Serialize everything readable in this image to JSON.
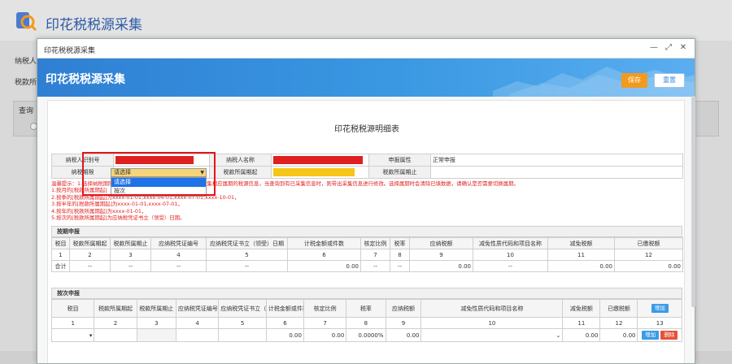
{
  "background": {
    "title": "印花税税源采集",
    "label_taxpayer": "纳税人",
    "label_period": "税款所",
    "query_label": "查询"
  },
  "modal": {
    "title": "印花税税源采集",
    "win_minimize": "—",
    "win_maximize": "⤢",
    "win_close": "✕",
    "banner_title": "印花税税源采集",
    "save_label": "保存",
    "reset_label": "重置"
  },
  "doc": {
    "title": "印花税税源明细表",
    "taxpayer_id_label": "纳税人识别号",
    "taxpayer_name_label": "纳税人名称",
    "declare_attr_label": "申报属性",
    "declare_attr_value": "正常申报",
    "tax_period_label": "纳税期限",
    "period_start_label": "税款所属期起",
    "period_end_label": "税款所属期止",
    "dropdown_value": "请选择",
    "dropdown_options": [
      "请选择",
      "按次"
    ],
    "tips": [
      "温馨提示：1.选择纳税期限时，税款所属期起止需要按照纳税期限采集相应属期的税源信息，当查询到有已采集信息时，则带出采集信息进行修改。选择属期时会清除已填数据，请确认是否需要切换属期。",
      "1.按月的[税款所属期起]",
      "2.按季的[税款所属期起]为xxxx-01-01,xxxx-04-01,xxxx-07-01,xxxx-10-01，",
      "3.按半年的[税款所属期起]为xxxx-01-01,xxxx-07-01，",
      "4.按年的[税款所属期起]为xxxx-01-01，",
      "5.按次的[税款所属期起]为应纳税凭证书立（领受）日期。"
    ]
  },
  "period_section": {
    "title": "按期申报",
    "headers": [
      "税目",
      "税款所属期起",
      "税款所属期止",
      "应纳税凭证编号",
      "应纳税凭证书立（领受）日期",
      "计税金额或件数",
      "核定比例",
      "税率",
      "应纳税额",
      "减免性质代码和项目名称",
      "减免税额",
      "已缴税额"
    ],
    "index_row": [
      "1",
      "2",
      "3",
      "4",
      "5",
      "6",
      "7",
      "8",
      "9",
      "10",
      "11",
      "12"
    ],
    "total_row": [
      "合计",
      "--",
      "--",
      "--",
      "--",
      "0.00",
      "--",
      "--",
      "0.00",
      "--",
      "0.00",
      "0.00"
    ]
  },
  "per_time_section": {
    "title": "按次申报",
    "headers": [
      "税目",
      "税款所属期起",
      "税款所属期止",
      "应纳税凭证编号",
      "应纳税凭证书立（领受）日期",
      "计税金额或件数",
      "核定比例",
      "税率",
      "应纳税额",
      "减免性质代码和项目名称",
      "减免税额",
      "已缴税额"
    ],
    "add_label": "增加",
    "index_row": [
      "1",
      "2",
      "3",
      "4",
      "5",
      "6",
      "7",
      "8",
      "9",
      "10",
      "11",
      "12",
      "13"
    ],
    "data_row": [
      "",
      "",
      "",
      "",
      "",
      "0.00",
      "0.00",
      "0.0000%",
      "0.00",
      "",
      "0.00",
      "0.00"
    ],
    "row_add_label": "增加",
    "row_delete_label": "删除"
  },
  "colors": {
    "banner": "#2f7fd3",
    "save": "#f39a1d",
    "tip_red": "#e02020",
    "highlight": "#e3141b"
  }
}
